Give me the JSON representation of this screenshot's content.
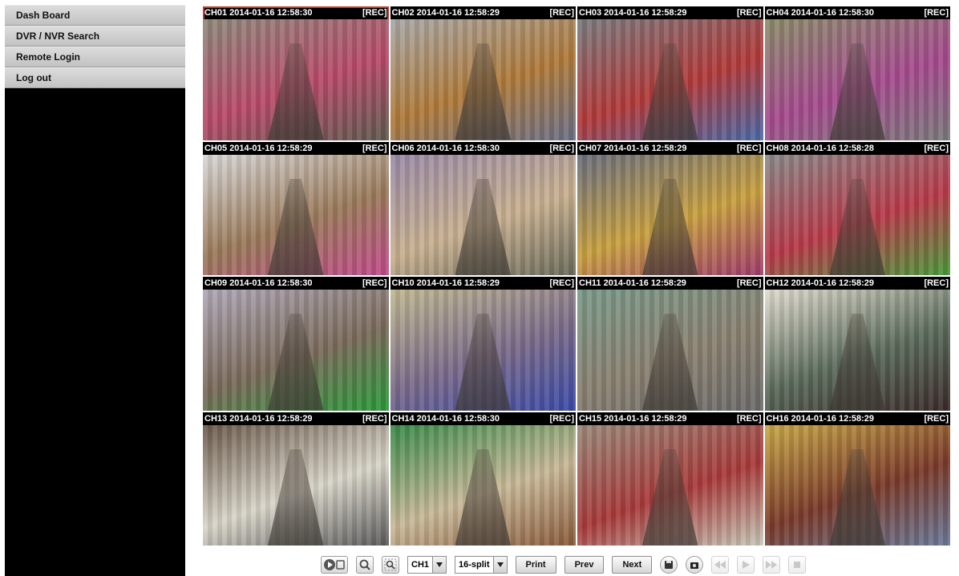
{
  "sidebar": {
    "items": [
      {
        "label": "Dash Board"
      },
      {
        "label": "DVR / NVR Search"
      },
      {
        "label": "Remote Login"
      },
      {
        "label": "Log out"
      }
    ]
  },
  "cameras": [
    {
      "title": "CH01 2014-01-16 12:58:30",
      "rec": "[REC]"
    },
    {
      "title": "CH02 2014-01-16 12:58:29",
      "rec": "[REC]"
    },
    {
      "title": "CH03 2014-01-16 12:58:29",
      "rec": "[REC]"
    },
    {
      "title": "CH04 2014-01-16 12:58:30",
      "rec": "[REC]"
    },
    {
      "title": "CH05 2014-01-16 12:58:29",
      "rec": "[REC]"
    },
    {
      "title": "CH06 2014-01-16 12:58:30",
      "rec": "[REC]"
    },
    {
      "title": "CH07 2014-01-16 12:58:29",
      "rec": "[REC]"
    },
    {
      "title": "CH08 2014-01-16 12:58:28",
      "rec": "[REC]"
    },
    {
      "title": "CH09 2014-01-16 12:58:30",
      "rec": "[REC]"
    },
    {
      "title": "CH10 2014-01-16 12:58:29",
      "rec": "[REC]"
    },
    {
      "title": "CH11 2014-01-16 12:58:29",
      "rec": "[REC]"
    },
    {
      "title": "CH12 2014-01-16 12:58:29",
      "rec": "[REC]"
    },
    {
      "title": "CH13 2014-01-16 12:58:29",
      "rec": "[REC]"
    },
    {
      "title": "CH14 2014-01-16 12:58:30",
      "rec": "[REC]"
    },
    {
      "title": "CH15 2014-01-16 12:58:29",
      "rec": "[REC]"
    },
    {
      "title": "CH16 2014-01-16 12:58:29",
      "rec": "[REC]"
    }
  ],
  "toolbar": {
    "channel_select": "CH1",
    "split_select": "16-split",
    "print_label": "Print",
    "prev_label": "Prev",
    "next_label": "Next"
  },
  "colors": {
    "selected_border": "#c43a2a",
    "sidebar_bg": "#000000",
    "menu_bg": "#d0d0d0"
  },
  "icons": [
    "play-record-icon",
    "search-icon",
    "zoom-icon",
    "save-icon",
    "snapshot-icon",
    "rewind-icon",
    "play-icon",
    "fast-forward-icon",
    "stop-icon"
  ]
}
